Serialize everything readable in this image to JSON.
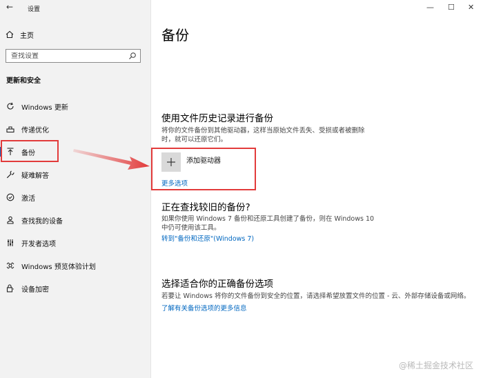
{
  "window": {
    "title": "设置",
    "back_glyph": "←",
    "minimize_glyph": "—",
    "maximize_glyph": "☐",
    "close_glyph": "✕"
  },
  "sidebar": {
    "home_label": "主页",
    "search_placeholder": "查找设置",
    "section_title": "更新和安全",
    "items": [
      {
        "label": "Windows 更新",
        "icon": "refresh-icon"
      },
      {
        "label": "传递优化",
        "icon": "delivery-optimization-icon"
      },
      {
        "label": "备份",
        "icon": "backup-icon",
        "active": true
      },
      {
        "label": "疑难解答",
        "icon": "wrench-icon"
      },
      {
        "label": "激活",
        "icon": "check-circle-icon"
      },
      {
        "label": "查找我的设备",
        "icon": "person-location-icon"
      },
      {
        "label": "开发者选项",
        "icon": "developer-sliders-icon"
      },
      {
        "label": "Windows 预览体验计划",
        "icon": "insider-icon"
      },
      {
        "label": "设备加密",
        "icon": "lock-icon"
      }
    ]
  },
  "main": {
    "title": "备份",
    "file_history": {
      "heading": "使用文件历史记录进行备份",
      "description_line1": "将你的文件备份到其他驱动器，这样当原始文件丢失、受损或者被删除",
      "description_line2": "时，就可以还原它们。",
      "add_drive_label": "添加驱动器",
      "more_options_link": "更多选项"
    },
    "older_backup": {
      "heading": "正在查找较旧的备份?",
      "description_line1": "如果你使用 Windows 7 备份和还原工具创建了备份，则在 Windows 10",
      "description_line2": "中仍可使用该工具。",
      "link": "转到\"备份和还原\"(Windows 7)"
    },
    "right_option": {
      "heading": "选择适合你的正确备份选项",
      "description": "若要让 Windows 将你的文件备份到安全的位置，请选择希望放置文件的位置 - 云、外部存储设备或网络。",
      "link": "了解有关备份选项的更多信息"
    }
  },
  "watermark": "@稀土掘金技术社区",
  "colors": {
    "accent": "#0067c0",
    "annotation_red": "#e23a3a",
    "sidebar_bg": "#f2f2f2"
  }
}
